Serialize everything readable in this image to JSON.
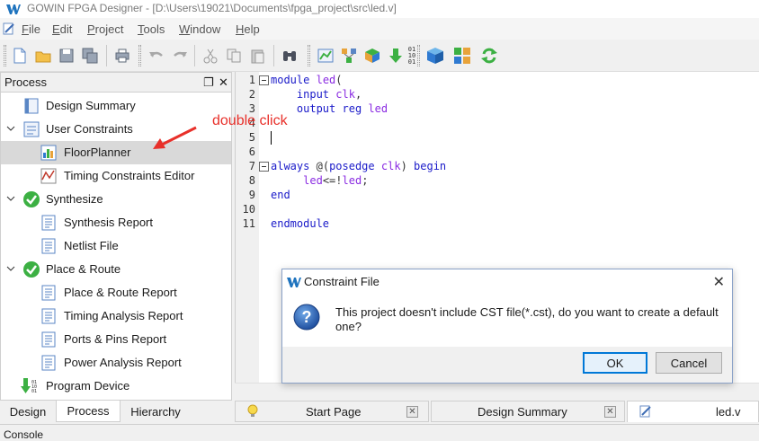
{
  "window": {
    "title": "GOWIN FPGA Designer - [D:\\Users\\19021\\Documents\\fpga_project\\src\\led.v]"
  },
  "menu": [
    {
      "label": "File",
      "mnemonic": "F"
    },
    {
      "label": "Edit",
      "mnemonic": "E"
    },
    {
      "label": "Project",
      "mnemonic": "P"
    },
    {
      "label": "Tools",
      "mnemonic": "T"
    },
    {
      "label": "Window",
      "mnemonic": "W"
    },
    {
      "label": "Help",
      "mnemonic": "H"
    }
  ],
  "toolbar": {
    "icons": [
      "new-file-icon",
      "open-folder-icon",
      "save-icon",
      "save-all-icon",
      "print-icon",
      "undo-icon",
      "redo-icon",
      "cut-icon",
      "copy-icon",
      "paste-icon",
      "find-icon",
      "synthesize-icon",
      "place-route-icon",
      "floorplanner-icon",
      "program-device-icon",
      "gowin-analyzer-icon",
      "rebuild-icon",
      "refresh-icon"
    ]
  },
  "process": {
    "title": "Process",
    "items": [
      {
        "label": "Design Summary",
        "icon": "document-icon",
        "level": 0,
        "status": "none"
      },
      {
        "label": "User Constraints",
        "icon": "constraints-icon",
        "level": 0,
        "expanded": true
      },
      {
        "label": "FloorPlanner",
        "icon": "floorplanner-icon",
        "level": 1,
        "selected": true
      },
      {
        "label": "Timing Constraints Editor",
        "icon": "timing-editor-icon",
        "level": 1
      },
      {
        "label": "Synthesize",
        "icon": "check-success-icon",
        "level": 0,
        "expanded": true
      },
      {
        "label": "Synthesis Report",
        "icon": "report-icon",
        "level": 1
      },
      {
        "label": "Netlist File",
        "icon": "report-icon",
        "level": 1
      },
      {
        "label": "Place & Route",
        "icon": "check-success-icon",
        "level": 0,
        "expanded": true
      },
      {
        "label": "Place & Route Report",
        "icon": "report-icon",
        "level": 1
      },
      {
        "label": "Timing Analysis Report",
        "icon": "report-icon",
        "level": 1
      },
      {
        "label": "Ports & Pins Report",
        "icon": "report-icon",
        "level": 1
      },
      {
        "label": "Power Analysis Report",
        "icon": "report-icon",
        "level": 1
      },
      {
        "label": "Program Device",
        "icon": "program-device-icon",
        "level": 0
      }
    ]
  },
  "left_tabs": [
    {
      "label": "Design",
      "active": false
    },
    {
      "label": "Process",
      "active": true
    },
    {
      "label": "Hierarchy",
      "active": false
    }
  ],
  "editor": {
    "lines": [
      {
        "n": "1",
        "text": "module led(",
        "fold": true
      },
      {
        "n": "2",
        "text": "    input clk,"
      },
      {
        "n": "3",
        "text": "    output reg led"
      },
      {
        "n": "4",
        "text": ""
      },
      {
        "n": "5",
        "text": ""
      },
      {
        "n": "6",
        "text": ""
      },
      {
        "n": "7",
        "text": "always @(posedge clk) begin",
        "fold": true
      },
      {
        "n": "8",
        "text": "     led<=!led;"
      },
      {
        "n": "9",
        "text": "end"
      },
      {
        "n": "10",
        "text": ""
      },
      {
        "n": "11",
        "text": "endmodule"
      }
    ]
  },
  "right_tabs": [
    {
      "label": "Start Page",
      "icon": "lightbulb-icon"
    },
    {
      "label": "Design Summary"
    },
    {
      "label": "led.v",
      "icon": "edit-file-icon",
      "active": true
    }
  ],
  "console": {
    "label": "Console"
  },
  "dialog": {
    "title": "Constraint File",
    "message": "This project doesn't include CST file(*.cst), do you want to create a default one?",
    "ok_label": "OK",
    "cancel_label": "Cancel"
  },
  "annotation": {
    "text": "double click",
    "color": "#e8302a"
  },
  "colors": {
    "accent": "#0078d7",
    "success": "#3cb043",
    "keyword": "#1a1ac9"
  }
}
